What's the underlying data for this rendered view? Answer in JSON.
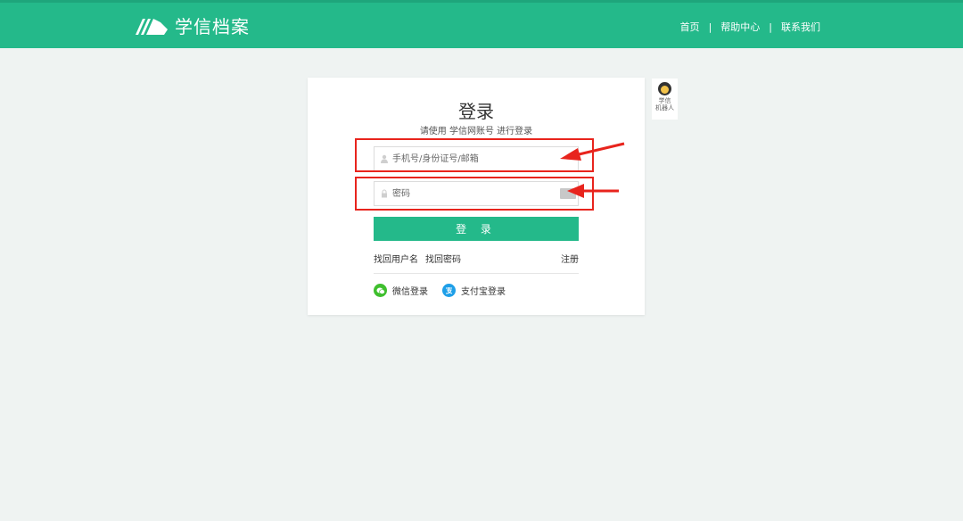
{
  "header": {
    "logo_text": "学信档案",
    "nav": [
      "首页",
      "帮助中心",
      "联系我们"
    ],
    "separator": "|"
  },
  "login": {
    "title": "登录",
    "subtitle": "请使用 学信网账号 进行登录",
    "username_placeholder": "手机号/身份证号/邮箱",
    "username_value": "",
    "password_placeholder": "密码",
    "password_value": "",
    "submit_label": "登 录",
    "forgot_username": "找回用户名",
    "forgot_password": "找回密码",
    "register": "注册",
    "wechat_login": "微信登录",
    "alipay_login": "支付宝登录"
  },
  "robot": {
    "line1": "学信",
    "line2": "机器人"
  },
  "icons": {
    "user": "user-icon",
    "lock": "lock-icon",
    "eye": "password-toggle-icon",
    "wechat": "wechat-icon",
    "alipay": "alipay-icon",
    "logo": "chsi-logo-icon"
  },
  "colors": {
    "brand_green": "#24b98a",
    "page_bg": "#eff3f2",
    "annotation_red": "#e8241d",
    "wechat_green": "#3fbf2e",
    "alipay_blue": "#1e9fe8"
  }
}
